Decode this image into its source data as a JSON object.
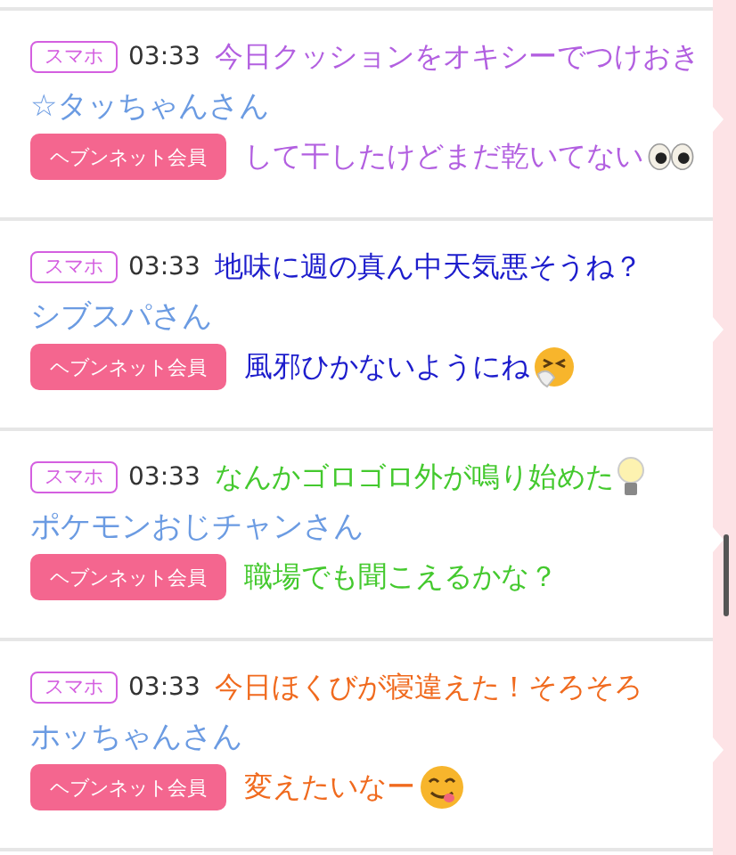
{
  "posts": [
    {
      "device": "スマホ",
      "time": "03:33",
      "name": "☆タッちゃんさん",
      "member_button": "ヘブンネット会員",
      "overlay": {
        "color": "#b25fe0",
        "lines": [
          "今日クッションをオキシーでつけおき",
          "して干したけどまだ乾いてない"
        ],
        "kind": "eyes"
      }
    },
    {
      "device": "スマホ",
      "time": "03:33",
      "name": "シブスパさん",
      "member_button": "ヘブンネット会員",
      "overlay": {
        "color": "#1c1ccc",
        "lines": [
          "地味に週の真ん中天気悪そうね？",
          "風邪ひかないようにね"
        ],
        "kind": "sneeze"
      }
    },
    {
      "device": "スマホ",
      "time": "03:33",
      "name": "ポケモンおじチャンさん",
      "member_button": "ヘブンネット会員",
      "overlay": {
        "color": "#44c92e",
        "lines": [
          "なんかゴロゴロ外が鳴り始めた",
          "職場でも聞こえるかな？"
        ],
        "kind": "bulb"
      }
    },
    {
      "device": "スマホ",
      "time": "03:33",
      "name": "ホッちゃんさん",
      "member_button": "ヘブンネット会員",
      "overlay": {
        "color": "#f06a1e",
        "lines": [
          "今日ほくびが寝違えた！そろそろ",
          "変えたいなー"
        ],
        "kind": "yum"
      }
    }
  ]
}
